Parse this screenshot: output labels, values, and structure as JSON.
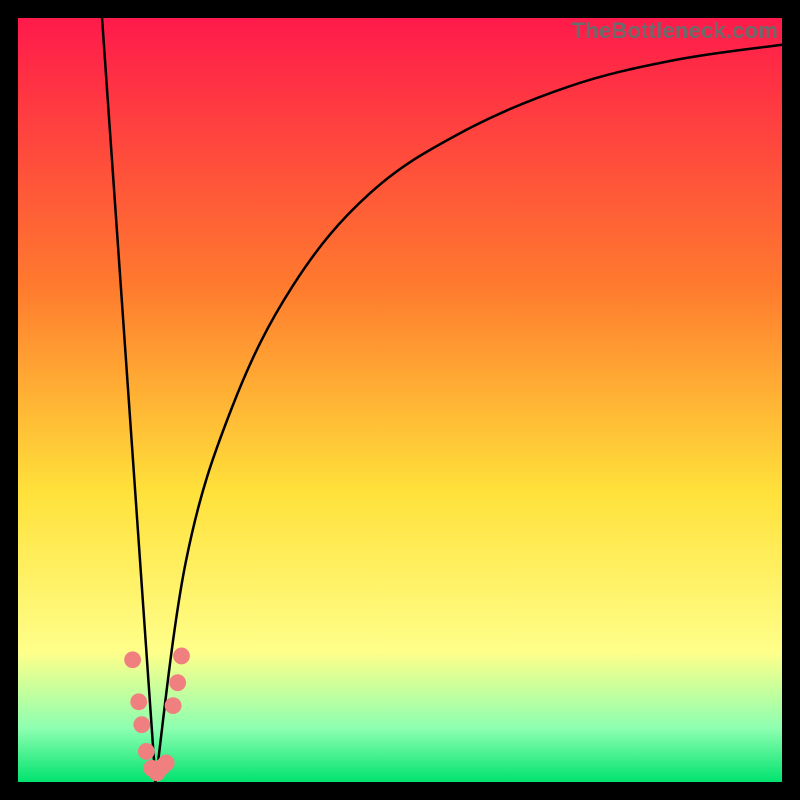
{
  "watermark": "TheBottleneck.com",
  "colors": {
    "black": "#000000",
    "curve": "#000000",
    "dots": "#f08080",
    "grad_top": "#ff1a4b",
    "grad_mid1": "#ff7a2e",
    "grad_mid2": "#ffe13a",
    "grad_yellow_pale": "#ffff8a",
    "grad_green_pale": "#8dffb0",
    "grad_green": "#00e36e"
  },
  "chart_data": {
    "type": "line",
    "title": "",
    "xlabel": "",
    "ylabel": "",
    "xlim": [
      0,
      100
    ],
    "ylim": [
      0,
      100
    ],
    "x_vertex": 18,
    "left_branch": {
      "x_start": 11,
      "y_start": 100,
      "x_end": 18,
      "y_end": 0
    },
    "right_branch_curve": [
      [
        18,
        0
      ],
      [
        22,
        29
      ],
      [
        28,
        49
      ],
      [
        36,
        65
      ],
      [
        46,
        77
      ],
      [
        58,
        85
      ],
      [
        72,
        91
      ],
      [
        86,
        94.5
      ],
      [
        100,
        96.5
      ]
    ],
    "dots": [
      {
        "x": 15.0,
        "y": 16.0
      },
      {
        "x": 15.8,
        "y": 10.5
      },
      {
        "x": 16.2,
        "y": 7.5
      },
      {
        "x": 16.8,
        "y": 4.0
      },
      {
        "x": 17.5,
        "y": 1.8
      },
      {
        "x": 18.2,
        "y": 1.2
      },
      {
        "x": 18.9,
        "y": 2.0
      },
      {
        "x": 19.4,
        "y": 2.5
      },
      {
        "x": 20.3,
        "y": 10.0
      },
      {
        "x": 20.9,
        "y": 13.0
      },
      {
        "x": 21.4,
        "y": 16.5
      }
    ],
    "dot_radius_pct": 1.1
  }
}
